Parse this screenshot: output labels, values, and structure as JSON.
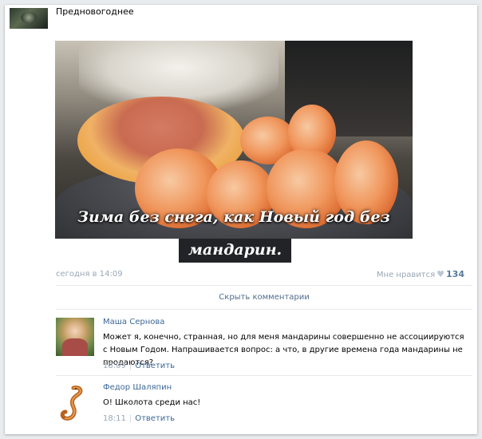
{
  "post": {
    "header_text": "Предновогоднее",
    "image_caption_line1": "Зима без снега, как Новый год без",
    "image_caption_line2": "мандарин.",
    "time": "сегодня в 14:09",
    "likes_label": "Мне нравится",
    "likes_count": "134",
    "hide_comments_label": "Скрыть комментарии"
  },
  "comments": [
    {
      "author": "Маша Сернова",
      "text": "Может я, конечно, странная, но для меня мандарины совершенно не ассоциируются с Новым Годом. Напрашивается вопрос: а что, в другие времена года мандарины не продаются?",
      "time": "18:09",
      "reply_label": "Ответить"
    },
    {
      "author": "Федор Шаляпин",
      "text": "О! Школота среди нас!",
      "time": "18:11",
      "reply_label": "Ответить"
    }
  ],
  "icons": {
    "like": "heart-icon",
    "avatar_2": "snake-icon"
  },
  "colors": {
    "link": "#3b6798",
    "muted": "#9aa7b6",
    "accent_count": "#58799d"
  }
}
